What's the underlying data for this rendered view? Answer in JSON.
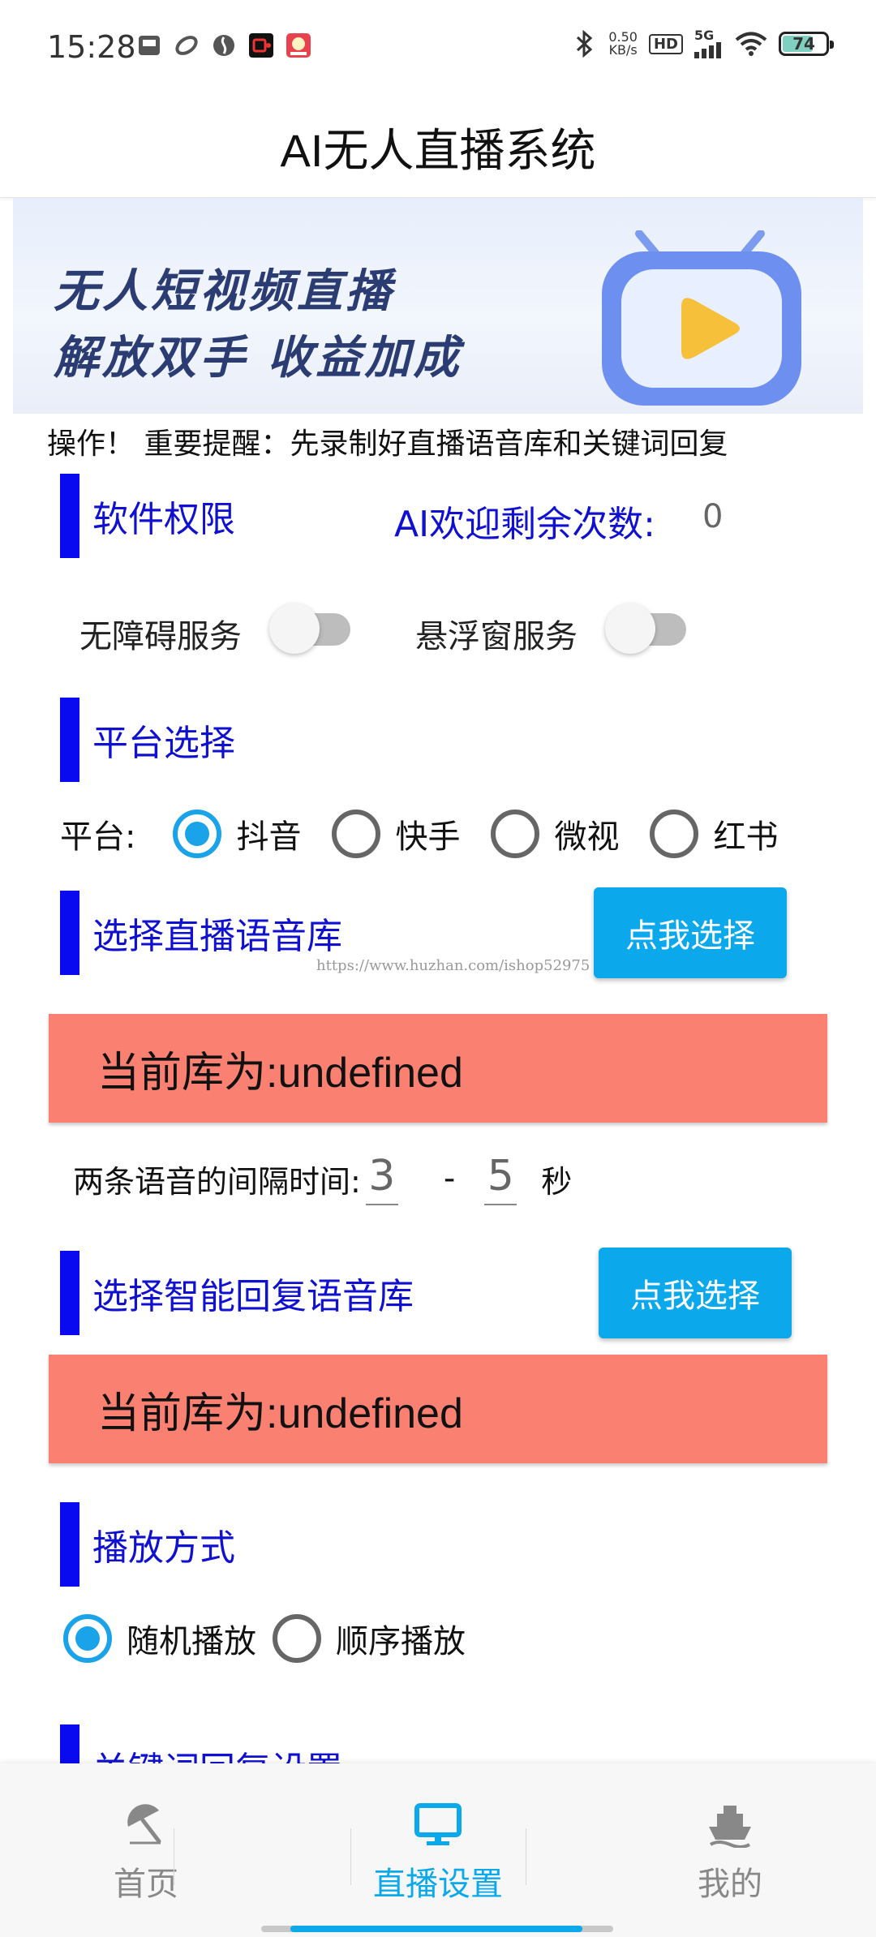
{
  "status_bar": {
    "time": "15:28",
    "net_speed_value": "0.50",
    "net_speed_unit": "KB/s",
    "hd": "HD",
    "signal": "5G",
    "battery": "74"
  },
  "header": {
    "title": "AI无人直播系统"
  },
  "banner": {
    "line1": "无人短视频直播",
    "line2": "解放双手 收益加成"
  },
  "marquee": "操作！ 重要提醒：先录制好直播语音库和关键词回复",
  "permissions": {
    "title": "软件权限",
    "ai_label": "AI欢迎剩余次数:",
    "ai_count": "0",
    "accessibility_label": "无障碍服务",
    "accessibility_on": false,
    "float_label": "悬浮窗服务",
    "float_on": false
  },
  "platform": {
    "title": "平台选择",
    "label": "平台:",
    "options": [
      "抖音",
      "快手",
      "微视",
      "红书"
    ],
    "selected": "抖音"
  },
  "live_lib": {
    "title": "选择直播语音库",
    "button": "点我选择",
    "current": "当前库为:undefined"
  },
  "watermark": "https://www.huzhan.com/ishop52975",
  "interval": {
    "label": "两条语音的间隔时间:",
    "min": "3",
    "dash": "-",
    "max": "5",
    "unit": "秒"
  },
  "reply_lib": {
    "title": "选择智能回复语音库",
    "button": "点我选择",
    "current": "当前库为:undefined"
  },
  "play_mode": {
    "title": "播放方式",
    "options": [
      "随机播放",
      "顺序播放"
    ],
    "selected": "随机播放"
  },
  "keyword_section": {
    "title": "关键词回复设置"
  },
  "bottom_nav": {
    "items": [
      {
        "label": "首页",
        "icon": "umbrella-icon"
      },
      {
        "label": "直播设置",
        "icon": "monitor-icon"
      },
      {
        "label": "我的",
        "icon": "ship-icon"
      }
    ],
    "active": "直播设置"
  },
  "colors": {
    "accent": "#0ba9ec",
    "section_bar": "#0a0af0",
    "section_text": "#1010d0",
    "library_box": "#fa8072"
  }
}
